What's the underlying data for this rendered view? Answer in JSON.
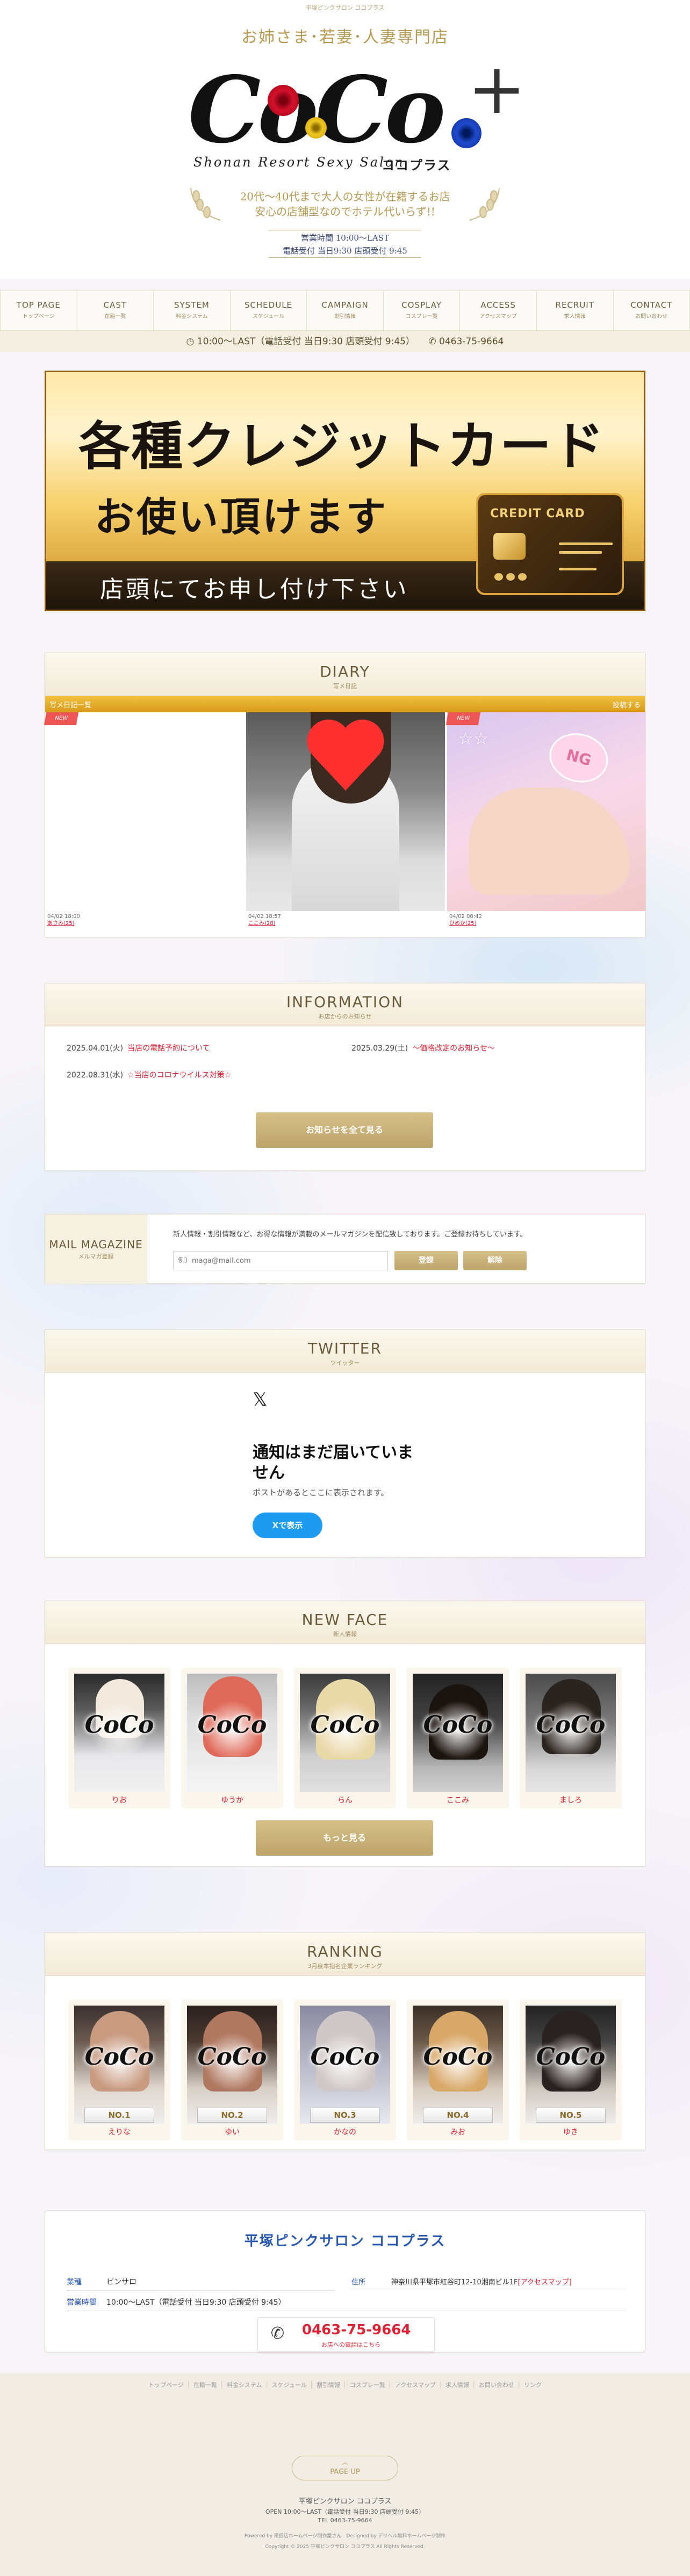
{
  "header": {
    "top_tagline": "平塚ピンクサロン ココプラス",
    "subtitle": "お姉さま･若妻･人妻専門店",
    "logo_text": "CoCo",
    "logo_plus": "+",
    "logo_tagline": "Shonan Resort Sexy Salon",
    "logo_kana": "ココプラス",
    "catch_line1": "20代～40代まで大人の女性が在籍するお店",
    "catch_line2": "安心の店舗型なのでホテル代いらず!!",
    "hours_line1": "営業時間 10:00～LAST",
    "hours_line2": "電話受付 当日9:30 店頭受付 9:45"
  },
  "nav": [
    {
      "en": "TOP PAGE",
      "jp": "トップページ"
    },
    {
      "en": "CAST",
      "jp": "在籍一覧"
    },
    {
      "en": "SYSTEM",
      "jp": "料金システム"
    },
    {
      "en": "SCHEDULE",
      "jp": "スケジュール"
    },
    {
      "en": "CAMPAIGN",
      "jp": "割引情報"
    },
    {
      "en": "COSPLAY",
      "jp": "コスプレ一覧"
    },
    {
      "en": "ACCESS",
      "jp": "アクセスマップ"
    },
    {
      "en": "RECRUIT",
      "jp": "求人情報"
    },
    {
      "en": "CONTACT",
      "jp": "お問い合わせ"
    }
  ],
  "infobar": {
    "hours": "10:00～LAST（電話受付 当日9:30 店頭受付 9:45）",
    "phone": "0463-75-9664"
  },
  "banner": {
    "line1": "各種クレジットカード",
    "line2": "お使い頂けます",
    "line3": "店頭にてお申し付け下さい",
    "card_label": "CREDIT CARD"
  },
  "diary": {
    "title": "DIARY",
    "subtitle": "写メ日記",
    "bar_left": "写メ日記一覧",
    "bar_right": "投稿する",
    "posts": [
      {
        "date": "04/02 18:00",
        "name": "あさみ(25)",
        "badge": "NEW"
      },
      {
        "date": "04/02 18:57",
        "name": "ここみ(28)",
        "badge": ""
      },
      {
        "date": "04/02 08:42",
        "name": "ひめか(25)",
        "badge": "NEW",
        "sticker": "NG"
      }
    ]
  },
  "information": {
    "title": "INFORMATION",
    "subtitle": "お店からのお知らせ",
    "items": [
      {
        "date": "2025.04.01(火)",
        "text": "当店の電話予約について"
      },
      {
        "date": "2025.03.29(土)",
        "text": "～価格改定のお知らせ～"
      },
      {
        "date": "2022.08.31(水)",
        "text": "☆当店のコロナウイルス対策☆"
      }
    ],
    "button": "お知らせを全て見る"
  },
  "mail": {
    "title": "MAIL MAGAZINE",
    "subtitle": "メルマガ登録",
    "description": "新人情報・割引情報など、お得な情報が満載のメールマガジンを配信致しております。ご登録お待ちしています。",
    "placeholder": "例）maga@mail.com",
    "register": "登録",
    "cancel": "解除"
  },
  "twitter": {
    "title": "TWITTER",
    "subtitle": "ツイッター",
    "logo": "𝕏",
    "heading_line1": "通知はまだ届いていま",
    "heading_line2": "せん",
    "body": "ポストがあるとここに表示されます。",
    "button": "Xで表示"
  },
  "newface": {
    "title": "NEW FACE",
    "subtitle": "新人情報",
    "names": [
      "りお",
      "ゆうか",
      "らん",
      "ここみ",
      "ましろ"
    ],
    "button": "もっと見る"
  },
  "ranking": {
    "title": "RANKING",
    "subtitle": "3月度本指名企業ランキング",
    "items": [
      {
        "rank": "NO.1",
        "name": "えりな"
      },
      {
        "rank": "NO.2",
        "name": "ゆい"
      },
      {
        "rank": "NO.3",
        "name": "かなの"
      },
      {
        "rank": "NO.4",
        "name": "みお"
      },
      {
        "rank": "NO.5",
        "name": "ゆき"
      }
    ]
  },
  "shop": {
    "title": "平塚ピンクサロン ココプラス",
    "type_label": "業種",
    "type": "ピンサロ",
    "address_label": "住所",
    "address": "神奈川県平塚市紅谷町12-10湘南ビル1F",
    "access_link": "[アクセスマップ]",
    "hours_label": "営業時間",
    "hours": "10:00～LAST（電話受付 当日9:30 店頭受付 9:45）",
    "phone": "0463-75-9664",
    "phone_sub": "お店への電話はこちら"
  },
  "footer": {
    "links": "トップページ ｜ 在籍一覧 ｜ 料金システム ｜ スケジュール ｜ 割引情報 ｜ コスプレ一覧 ｜ アクセスマップ ｜ 求人情報 ｜ お問い合わせ ｜ リンク",
    "pageup_symbol": "︿",
    "pageup": "PAGE UP",
    "shop": "平塚ピンクサロン ココプラス",
    "open": "OPEN 10:00～LAST（電話受付 当日9:30 店頭受付 9:45）",
    "tel": "TEL 0463-75-9664",
    "powered": "Powered by 風俗店ホームページ制作屋さん　Designed by デリヘル無料ホームページ制作",
    "copyright": "Copyright © 2025 平塚ピンクサロン ココプラス All Rights Reserved."
  },
  "colors": {
    "gold": "#b59a55",
    "accent_red": "#d23",
    "shop_blue": "#2a58b0",
    "x_blue": "#1d9bf0"
  }
}
